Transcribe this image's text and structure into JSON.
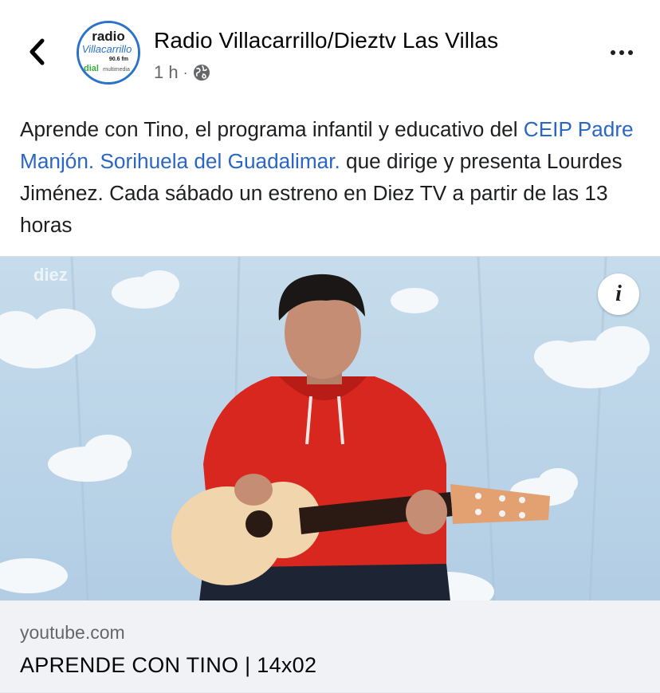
{
  "header": {
    "page_name": "Radio Villacarrillo/Dieztv Las Villas",
    "time": "1 h",
    "separator": "·",
    "avatar_logo": {
      "line1": "radio",
      "line2": "Villacarrillo",
      "line3": "90.6 fm",
      "line4": "dial",
      "line5": "multimedia"
    }
  },
  "post": {
    "text_before": "Aprende con Tino, el programa infantil y educativo del ",
    "link_text": "CEIP Padre Manjón. Sorihuela del Guadalimar.",
    "text_after": " que dirige y presenta Lourdes Jiménez. Cada sábado un estreno en Diez TV a partir de las 13 horas"
  },
  "media": {
    "watermark": "diez",
    "info_label": "i"
  },
  "link_card": {
    "domain": "youtube.com",
    "title": "APRENDE CON TINO | 14x02"
  },
  "colors": {
    "link": "#2a66c4",
    "secondary_text": "#65676b",
    "card_bg": "#f0f2f5",
    "sky": "#bcd6ea",
    "hoodie": "#d8271f",
    "avatar_ring": "#2a73c9"
  },
  "icons": {
    "back": "chevron-left-icon",
    "privacy": "globe-icon",
    "more": "more-dots-icon",
    "info": "info-icon"
  }
}
